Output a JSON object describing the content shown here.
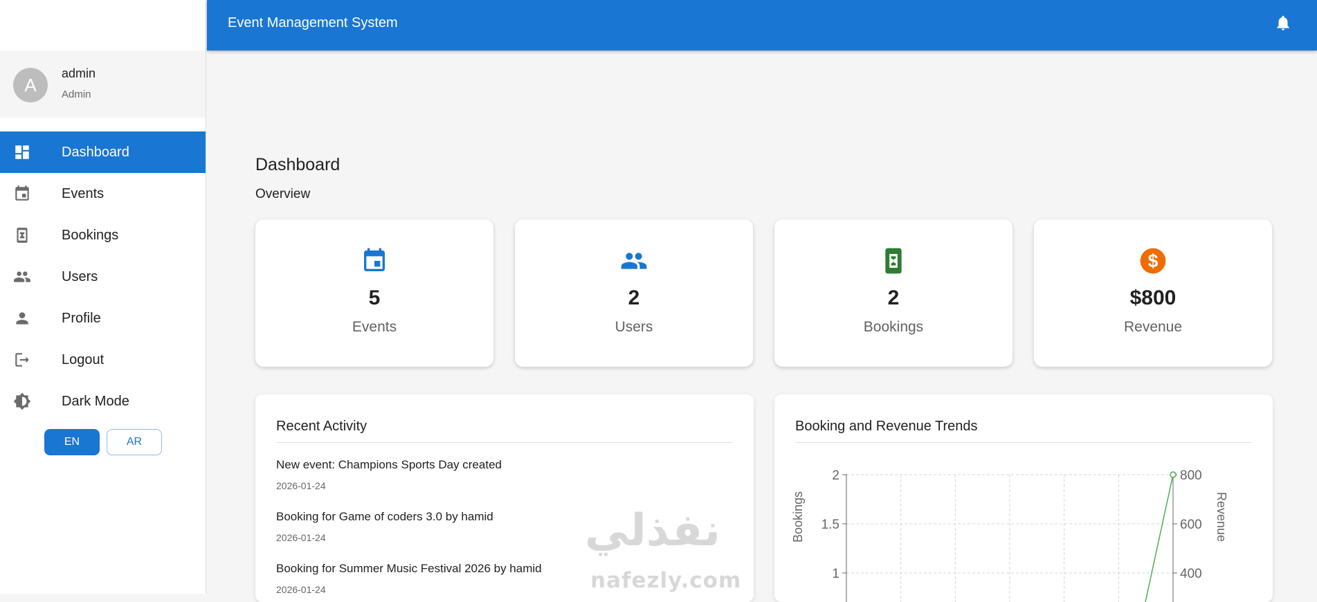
{
  "user": {
    "avatar_letter": "A",
    "name": "admin",
    "role": "Admin"
  },
  "nav": [
    {
      "label": "Dashboard",
      "icon": "dashboard-icon",
      "active": true
    },
    {
      "label": "Events",
      "icon": "calendar-icon"
    },
    {
      "label": "Bookings",
      "icon": "ticket-icon"
    },
    {
      "label": "Users",
      "icon": "people-icon"
    },
    {
      "label": "Profile",
      "icon": "person-icon"
    },
    {
      "label": "Logout",
      "icon": "logout-icon"
    },
    {
      "label": "Dark Mode",
      "icon": "brightness-icon"
    }
  ],
  "language": {
    "en": "EN",
    "ar": "AR",
    "selected": "EN"
  },
  "appbar": {
    "title": "Event Management System",
    "notification_icon": "bell-icon"
  },
  "page": {
    "title": "Dashboard",
    "subtitle": "Overview"
  },
  "stats": [
    {
      "value": "5",
      "label": "Events",
      "icon": "calendar-icon",
      "color": "#1976d2"
    },
    {
      "value": "2",
      "label": "Users",
      "icon": "people-icon",
      "color": "#1976d2"
    },
    {
      "value": "2",
      "label": "Bookings",
      "icon": "ticket-icon",
      "color": "#2e7d32"
    },
    {
      "value": "$800",
      "label": "Revenue",
      "icon": "dollar-icon",
      "color": "#ef6c00"
    }
  ],
  "recent_activity": {
    "title": "Recent Activity",
    "items": [
      {
        "text": "New event: Champions Sports Day created",
        "date": "2026-01-24"
      },
      {
        "text": "Booking for Game of coders 3.0 by hamid",
        "date": "2026-01-24"
      },
      {
        "text": "Booking for Summer Music Festival 2026 by hamid",
        "date": "2026-01-24"
      }
    ]
  },
  "trends": {
    "title": "Booking and Revenue Trends"
  },
  "chart_data": {
    "type": "line",
    "title": "Booking and Revenue Trends",
    "ylabel": "Bookings",
    "y2label": "Revenue",
    "y_ticks": [
      "2",
      "1.5",
      "1"
    ],
    "y2_ticks": [
      "800",
      "600",
      "400"
    ],
    "grid": true,
    "series": [
      {
        "name": "Revenue",
        "color": "#4caf50",
        "last_value": 800
      }
    ]
  },
  "watermark": {
    "arabic": "نفذلي",
    "latin": "nafezly.com"
  },
  "colors": {
    "primary": "#1976d2",
    "bookings": "#2e7d32",
    "revenue": "#ef6c00",
    "line": "#4caf50"
  }
}
